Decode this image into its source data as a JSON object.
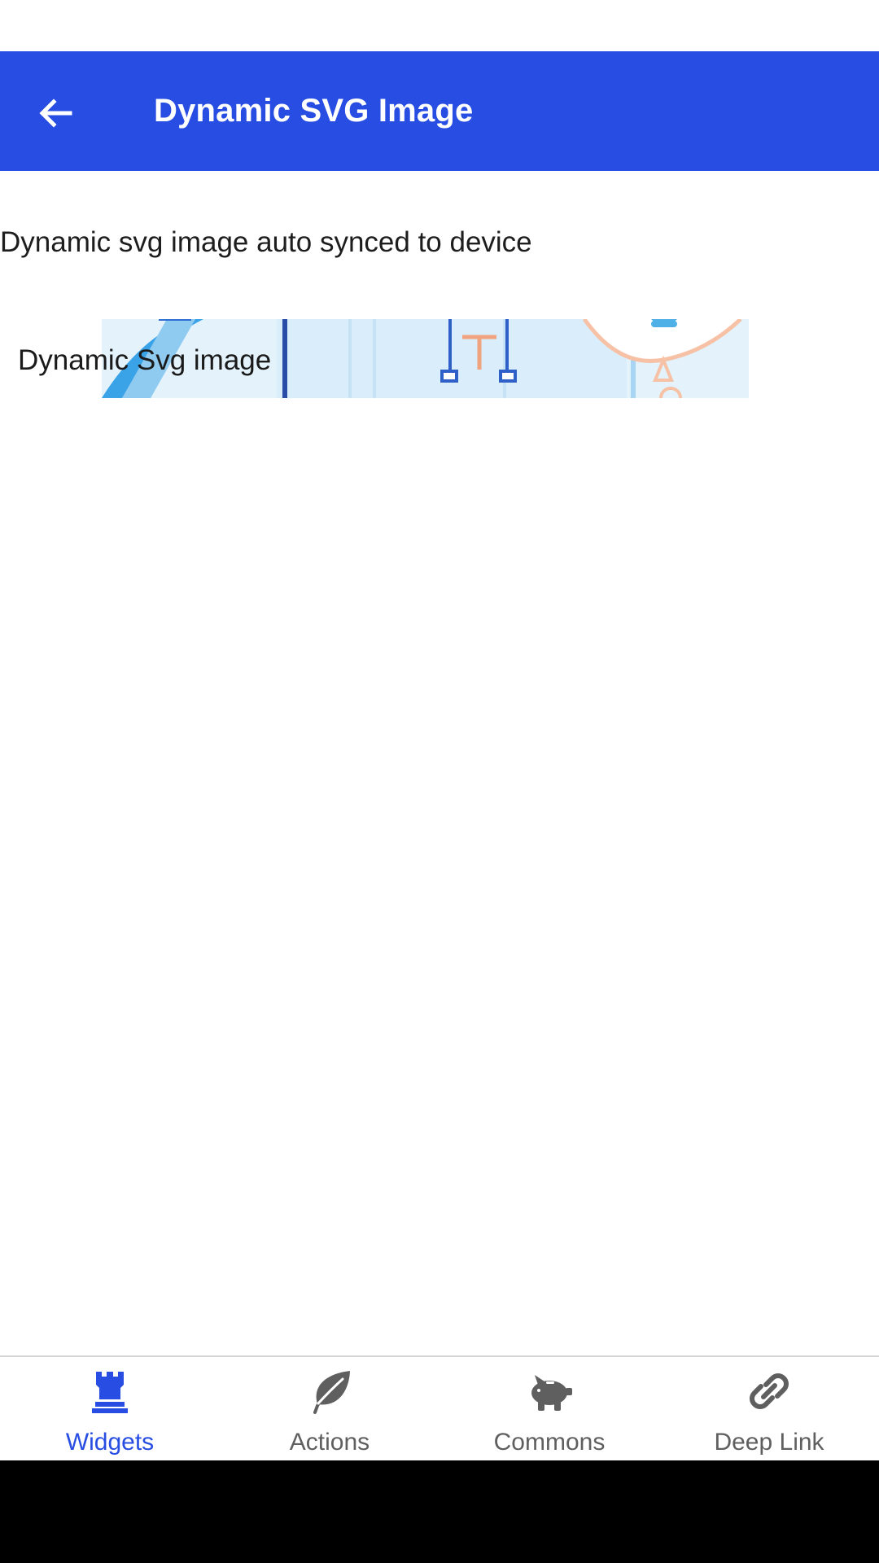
{
  "app_bar": {
    "title": "Dynamic SVG Image",
    "background": "#274de3"
  },
  "content": {
    "description": "Dynamic svg image auto synced to device",
    "svg_image_caption": "Dynamic Svg image"
  },
  "bottom_nav": {
    "active_color": "#274de3",
    "inactive_color": "#5f5f5f",
    "items": [
      {
        "label": "Widgets",
        "icon": "chess-rook-icon",
        "active": true
      },
      {
        "label": "Actions",
        "icon": "leaf-icon",
        "active": false
      },
      {
        "label": "Commons",
        "icon": "piggy-bank-icon",
        "active": false
      },
      {
        "label": "Deep Link",
        "icon": "link-icon",
        "active": false
      }
    ]
  }
}
